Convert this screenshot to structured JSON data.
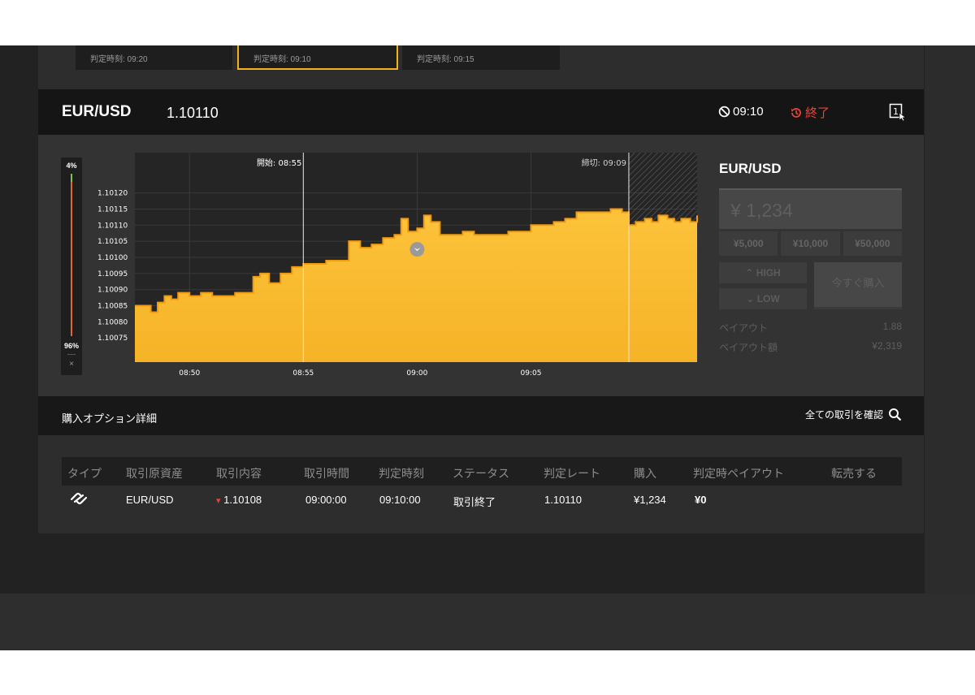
{
  "time_cards": [
    {
      "label": "判定時刻: 09:20"
    },
    {
      "label": "判定時刻: 09:10"
    },
    {
      "label": "判定時刻: 09:15"
    }
  ],
  "header": {
    "pair": "EUR/USD",
    "rate": "1.10110",
    "expiry_time": "09:10",
    "status": "終了"
  },
  "level_bar": {
    "top_pct": "4%",
    "bottom_pct": "96%",
    "close": "×"
  },
  "chart_data": {
    "type": "area",
    "series_color": "#f8bb2a",
    "y_ticks": [
      "1.10120",
      "1.10115",
      "1.10110",
      "1.10105",
      "1.10100",
      "1.10095",
      "1.10090",
      "1.10085",
      "1.10080",
      "1.10075"
    ],
    "y_tick_values": [
      1.1012,
      1.10115,
      1.1011,
      1.10105,
      1.101,
      1.10095,
      1.1009,
      1.10085,
      1.1008,
      1.10075
    ],
    "ylim": [
      1.100675,
      1.101325
    ],
    "x_ticks": [
      "08:50",
      "08:55",
      "09:00",
      "09:05"
    ],
    "x_tick_minutes": [
      530,
      535,
      540,
      545
    ],
    "xlim": [
      527.6,
      552.3
    ],
    "start_label": "開始: 08:55",
    "deadline_label": "締切: 09:09",
    "start_minute": 535,
    "deadline_minute": 549.3,
    "entry_marker": {
      "minute": 540,
      "value": 1.10103
    },
    "points": [
      [
        527.6,
        1.10085
      ],
      [
        528.0,
        1.10085
      ],
      [
        528.3,
        1.10083
      ],
      [
        528.6,
        1.10086
      ],
      [
        528.9,
        1.10088
      ],
      [
        529.2,
        1.10087
      ],
      [
        529.5,
        1.10089
      ],
      [
        530.0,
        1.10088
      ],
      [
        530.5,
        1.10089
      ],
      [
        531.0,
        1.10088
      ],
      [
        531.5,
        1.10088
      ],
      [
        532.0,
        1.10089
      ],
      [
        532.5,
        1.10089
      ],
      [
        532.8,
        1.10094
      ],
      [
        533.1,
        1.10095
      ],
      [
        533.5,
        1.10092
      ],
      [
        534.0,
        1.10095
      ],
      [
        534.5,
        1.10097
      ],
      [
        535.0,
        1.10098
      ],
      [
        535.5,
        1.10098
      ],
      [
        536.0,
        1.10099
      ],
      [
        536.5,
        1.10099
      ],
      [
        537.0,
        1.10105
      ],
      [
        537.5,
        1.10103
      ],
      [
        538.0,
        1.10104
      ],
      [
        538.5,
        1.10106
      ],
      [
        539.0,
        1.10107
      ],
      [
        539.3,
        1.10112
      ],
      [
        539.6,
        1.10108
      ],
      [
        540.0,
        1.10109
      ],
      [
        540.3,
        1.10113
      ],
      [
        540.6,
        1.10111
      ],
      [
        541.0,
        1.10107
      ],
      [
        541.5,
        1.10107
      ],
      [
        542.0,
        1.10108
      ],
      [
        542.5,
        1.10107
      ],
      [
        543.0,
        1.10107
      ],
      [
        543.5,
        1.10107
      ],
      [
        544.0,
        1.10108
      ],
      [
        544.5,
        1.10108
      ],
      [
        545.0,
        1.1011
      ],
      [
        545.5,
        1.1011
      ],
      [
        546.0,
        1.10111
      ],
      [
        546.5,
        1.10112
      ],
      [
        547.0,
        1.10114
      ],
      [
        547.5,
        1.10114
      ],
      [
        548.0,
        1.10114
      ],
      [
        548.5,
        1.10115
      ],
      [
        549.0,
        1.10114
      ],
      [
        549.3,
        1.1011
      ],
      [
        549.6,
        1.10111
      ],
      [
        550.0,
        1.10112
      ],
      [
        550.3,
        1.10111
      ],
      [
        550.6,
        1.10113
      ],
      [
        551.0,
        1.10112
      ],
      [
        551.3,
        1.10111
      ],
      [
        551.6,
        1.10112
      ],
      [
        552.0,
        1.10111
      ],
      [
        552.3,
        1.10113
      ]
    ]
  },
  "trade_panel": {
    "pair": "EUR/USD",
    "amount_placeholder": "¥ 1,234",
    "presets": [
      "¥5,000",
      "¥10,000",
      "¥50,000"
    ],
    "high_label": "HIGH",
    "low_label": "LOW",
    "buy_now_label": "今すぐ購入",
    "payout_label": "ペイアウト",
    "payout_value": "1.88",
    "payout_amount_label": "ペイアウト額",
    "payout_amount_value": "¥2,319"
  },
  "details": {
    "title": "購入オプション詳細",
    "link_label": "全ての取引を確認"
  },
  "table": {
    "headers": [
      "タイプ",
      "取引原資産",
      "取引内容",
      "取引時間",
      "判定時刻",
      "ステータス",
      "判定レート",
      "購入",
      "判定時ペイアウト",
      "転売する"
    ],
    "row": {
      "asset": "EUR/USD",
      "content": "1.10108",
      "trade_time": "09:00:00",
      "judge_time": "09:10:00",
      "status": "取引終了",
      "judge_rate": "1.10110",
      "purchase": "¥1,234",
      "payout": "¥0"
    }
  }
}
